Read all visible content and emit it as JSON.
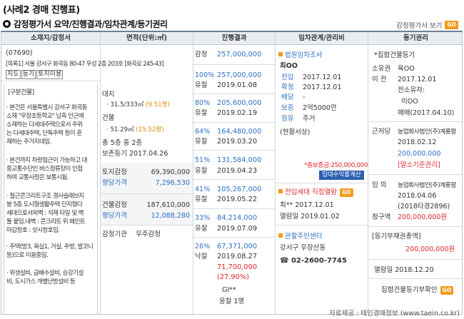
{
  "page": {
    "case_title": "(사례2 경매 진행표)",
    "section_title": "감정평가서 요약/진행결과/임차관계/등기권리",
    "report_link": "감정평가서 보기",
    "go": "GO",
    "credit": "자료제공 : 태인경매정보 (www.taein.co.kr)"
  },
  "columns": [
    "소재지/감정서",
    "면적(단위:㎡)",
    "진행결과",
    "임차관계/관리비",
    "등기권리"
  ],
  "location": {
    "postal": "(07690)",
    "address1": "[목록1] 서울 강서구 화곡동 80-47 우성 2층 203호 [화곡로 245-43]",
    "tags": [
      "지도",
      "등기",
      "토지이용"
    ],
    "bullets_title": "[구분건물]",
    "bullets": [
      [
        "· 본건은 서울특별시 강서구 화곡동",
        "  소재 \"우장초등학교\" 남측 인근에",
        "  소재하는 다세대주택으로서 주위",
        "  는 다세대주택, 단독주택 등이 혼",
        "  재하는 주거지대임."
      ],
      [
        "· 본건까지 차량접근이 가능하고 대",
        "  중교통수단인 버스정류장이 인접",
        "  하여 교통사정은 보통시됨."
      ],
      [
        "· 철근콘크리트구조 경사슬래브지",
        "  붕 5층 도시형생활주택 단지형다",
        "  세대으로서외벽 : 석재 타일 및 벽",
        "  돌 붙임.내벽 : 콘크리트 위 페인트",
        "  마감창호 : 샷시창호임."
      ],
      [
        "· 주택(방3, 욕실1, 거실, 주방, 발코니",
        "  등)으로 이용중임."
      ],
      [
        "· 위생설비, 급배수설비, 승강기설",
        "  비, 도시가스 개별난방설비 등"
      ]
    ]
  },
  "area": {
    "land_label": "대지",
    "land_value": "· 31.5/333㎡",
    "land_pyeong": "(9.51평)",
    "building_label": "건물",
    "building_value": "· 51.29㎡",
    "building_pyeong": "(15.52평)",
    "floors": "총 5층 중 2층",
    "approval": "보존등기 2017.04.26",
    "land_appraisal_label": "토지감정",
    "land_appraisal_value": "69,390,000",
    "land_pyeong_price_label": "평당가격",
    "land_pyeong_price_value": "7,296,530",
    "bldg_appraisal_label": "건물감정",
    "bldg_appraisal_value": "187,610,000",
    "bldg_pyeong_price_label": "평당가격",
    "bldg_pyeong_price_value": "12,088,280",
    "appraiser_label": "감정기관",
    "appraiser_value": "우주감정"
  },
  "results": {
    "appraisal_label": "감정",
    "appraisal_value": "257,000,000",
    "rounds": [
      {
        "pct": "100%",
        "price": "257,000,000",
        "status": "유찰",
        "date": "2019.01.08"
      },
      {
        "pct": "80%",
        "price": "205,600,000",
        "status": "유찰",
        "date": "2019.02.19"
      },
      {
        "pct": "64%",
        "price": "164,480,000",
        "status": "유찰",
        "date": "2019.03.20"
      },
      {
        "pct": "51%",
        "price": "131,584,000",
        "status": "유찰",
        "date": "2019.04.23"
      },
      {
        "pct": "41%",
        "price": "105,267,000",
        "status": "유찰",
        "date": "2019.05.22"
      },
      {
        "pct": "33%",
        "price": "84,214,000",
        "status": "유찰",
        "date": "2019.07.09"
      },
      {
        "pct": "26%",
        "price": "67,371,000",
        "status": "낙찰",
        "date": "2019.08.27"
      }
    ],
    "win_price": "71,700,000",
    "win_ratio": "(27.90%)",
    "winner": "GI**",
    "bidders": "응찰 1명"
  },
  "tenant": {
    "survey_title": "법원임차조사",
    "name": "최OO",
    "move_in_label": "전입",
    "move_in": "2017.12.01",
    "fixed_label": "확정",
    "fixed": "2017.12.01",
    "dividend_label": "배당",
    "dividend": "-",
    "deposit_label": "보증",
    "deposit": "2억5000만",
    "occupancy_label": "점유",
    "occupancy": "주거",
    "status": "(현황서상)",
    "total_deposit": "*총보증금:250,000,000",
    "calc_button": "임대수익률계산",
    "household_title": "전입세대 직접열람",
    "household_name": "최**  2017.12.01",
    "household_date": "열람일 2019.01.02",
    "office_title": "관할주민센터",
    "office_name": "강서구 우장산동",
    "office_phone": "☎ 02-2600-7745"
  },
  "registry": {
    "collective_title": "*집합건물등기",
    "owner_label": "소유권",
    "owner": "육OO",
    "transfer_label": "이 전",
    "transfer_date": "2017.12.01",
    "prev_owner_label": "전소유자:",
    "prev_owner": "이OO",
    "sale": "매매(2017.04.10)",
    "mortgage_label": "근저당",
    "mortgage_holder": "농업회사법인(주)계룡팜",
    "mortgage_date": "2018.02.12",
    "mortgage_amount": "200,000,000",
    "mortgage_note": "[말소기준권리]",
    "seizure_label": "임 의",
    "seizure_holder": "농업회사법인(주)계룡팜",
    "seizure_date": "2018.04.06",
    "seizure_case": "(2018타경2896)",
    "claim_label": "청구액",
    "claim_amount": "200,000,000원",
    "lien_title": "[등기부채권총액]",
    "lien_amount": "200,000,000원",
    "view_date": "열람일 2018.12.20",
    "collective_view": "집합건물등기부확인"
  }
}
